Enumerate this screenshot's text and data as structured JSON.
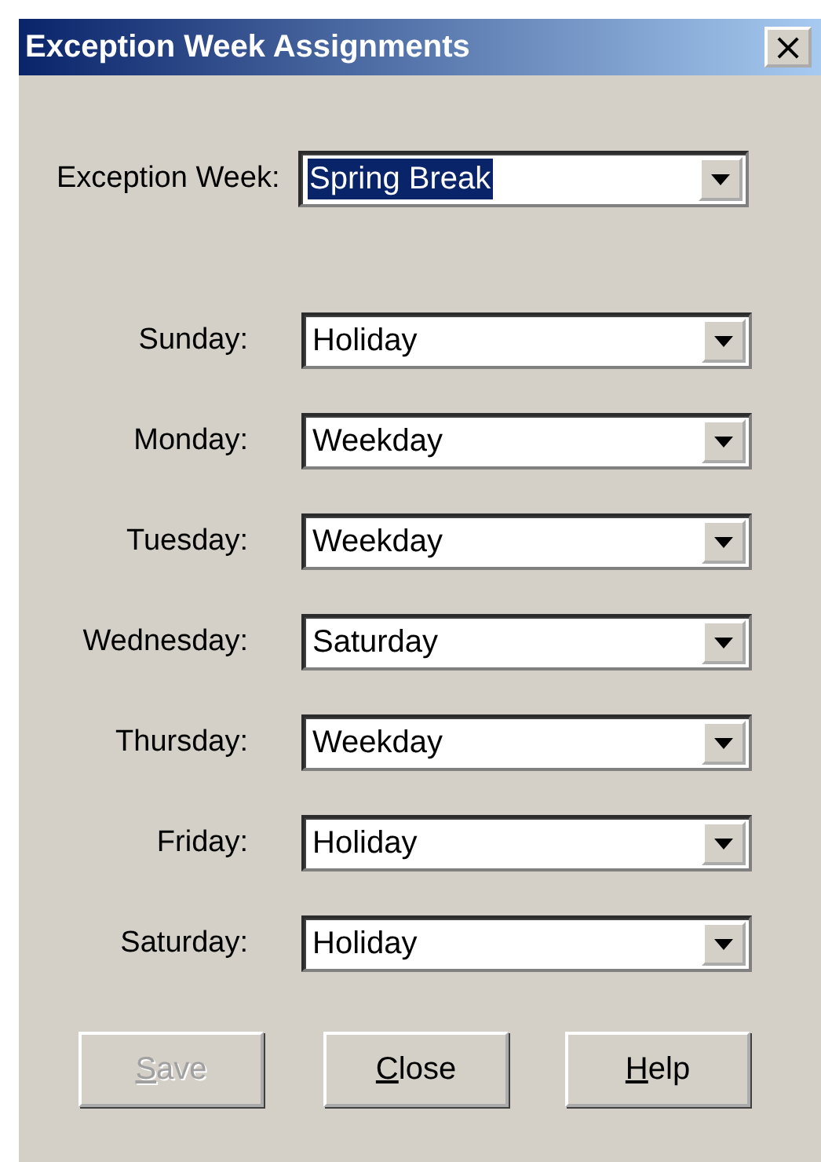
{
  "window": {
    "title": "Exception Week Assignments",
    "close_glyph": "×"
  },
  "exception_week": {
    "label": "Exception Week:",
    "value": "Spring Break",
    "highlighted": true
  },
  "days": [
    {
      "label": "Sunday:",
      "value": "Holiday"
    },
    {
      "label": "Monday:",
      "value": "Weekday"
    },
    {
      "label": "Tuesday:",
      "value": "Weekday"
    },
    {
      "label": "Wednesday:",
      "value": "Saturday"
    },
    {
      "label": "Thursday:",
      "value": "Weekday"
    },
    {
      "label": "Friday:",
      "value": "Holiday"
    },
    {
      "label": "Saturday:",
      "value": "Holiday"
    }
  ],
  "buttons": [
    {
      "label": "Save",
      "disabled": true
    },
    {
      "label": "Close",
      "disabled": false
    },
    {
      "label": "Help",
      "disabled": false
    }
  ]
}
